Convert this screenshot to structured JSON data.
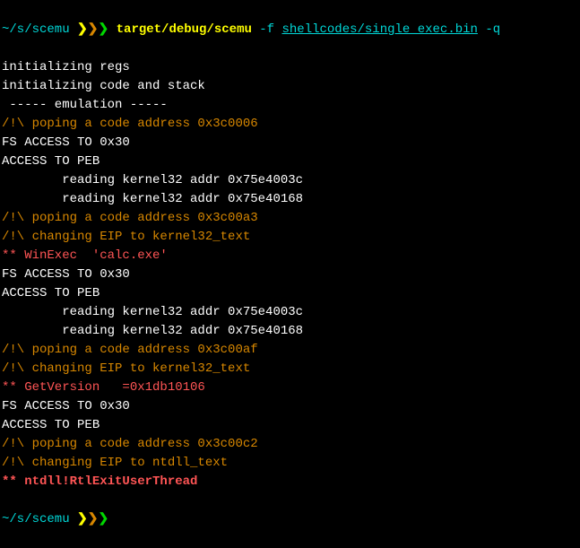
{
  "prompt1": {
    "path": "~/s/scemu",
    "chev": "❯❯❯",
    "cmd_bin": "target/debug/scemu",
    "cmd_flag1": " -f ",
    "cmd_file": "shellcodes/single_exec.bin",
    "cmd_flag2": " -q"
  },
  "out": [
    {
      "class": "white",
      "text": "initializing regs"
    },
    {
      "class": "white",
      "text": "initializing code and stack"
    },
    {
      "class": "white",
      "text": " ----- emulation -----"
    },
    {
      "class": "orange",
      "text": "/!\\ poping a code address 0x3c0006"
    },
    {
      "class": "white",
      "text": "FS ACCESS TO 0x30"
    },
    {
      "class": "white",
      "text": "ACCESS TO PEB"
    },
    {
      "class": "white",
      "text": "        reading kernel32 addr 0x75e4003c"
    },
    {
      "class": "white",
      "text": "        reading kernel32 addr 0x75e40168"
    },
    {
      "class": "orange",
      "text": "/!\\ poping a code address 0x3c00a3"
    },
    {
      "class": "orange",
      "text": "/!\\ changing EIP to kernel32_text"
    },
    {
      "class": "red",
      "text": "** WinExec  'calc.exe'"
    },
    {
      "class": "white",
      "text": "FS ACCESS TO 0x30"
    },
    {
      "class": "white",
      "text": "ACCESS TO PEB"
    },
    {
      "class": "white",
      "text": "        reading kernel32 addr 0x75e4003c"
    },
    {
      "class": "white",
      "text": "        reading kernel32 addr 0x75e40168"
    },
    {
      "class": "orange",
      "text": "/!\\ poping a code address 0x3c00af"
    },
    {
      "class": "orange",
      "text": "/!\\ changing EIP to kernel32_text"
    },
    {
      "class": "red",
      "text": "** GetVersion   =0x1db10106"
    },
    {
      "class": "white",
      "text": "FS ACCESS TO 0x30"
    },
    {
      "class": "white",
      "text": "ACCESS TO PEB"
    },
    {
      "class": "orange",
      "text": "/!\\ poping a code address 0x3c00c2"
    },
    {
      "class": "orange",
      "text": "/!\\ changing EIP to ntdll_text"
    },
    {
      "class": "red-bold",
      "text": "** ntdll!RtlExitUserThread "
    }
  ],
  "prompt2": {
    "path": "~/s/scemu",
    "chev": "❯❯❯"
  }
}
